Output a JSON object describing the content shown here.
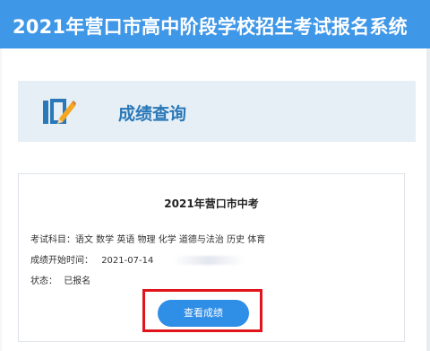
{
  "header": {
    "title": "2021年营口市高中阶段学校招生考试报名系统"
  },
  "section": {
    "title": "成绩查询",
    "icon": "document-edit-icon"
  },
  "exam": {
    "title": "2021年营口市中考",
    "subjects_label": "考试科目：",
    "subjects": "语文 数学 英语 物理 化学 道德与法治 历史 体育",
    "start_label": "成绩开始时间：",
    "start_date": "2021-07-14",
    "status_label": "状态：",
    "status": "已报名"
  },
  "actions": {
    "view_scores": "查看成绩"
  },
  "colors": {
    "header_bg": "#3f97e8",
    "accent": "#2f8ee6",
    "highlight_border": "#e0141a"
  }
}
